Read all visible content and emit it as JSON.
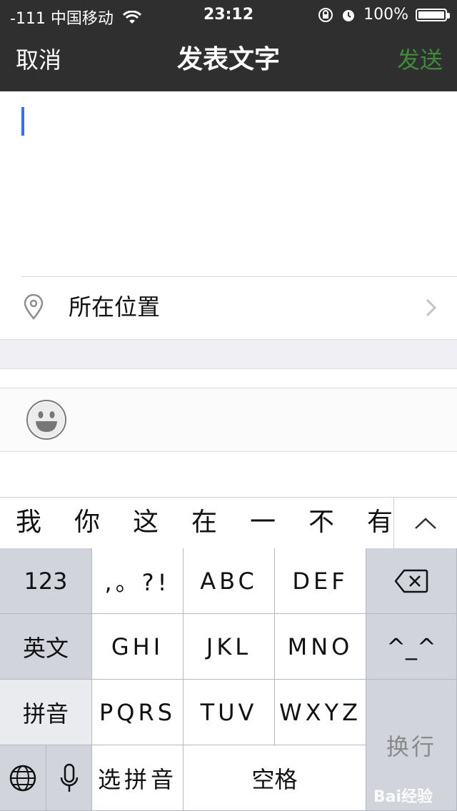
{
  "status_bar": {
    "carrier": "-111 中国移动",
    "time": "23:12",
    "battery": "100%"
  },
  "nav": {
    "cancel": "取消",
    "title": "发表文字",
    "send": "发送"
  },
  "location": {
    "label": "所在位置"
  },
  "candidates": [
    "我",
    "你",
    "这",
    "在",
    "一",
    "不",
    "有"
  ],
  "keyboard": {
    "left_col": [
      "123",
      "英文",
      "拼音"
    ],
    "rows": [
      [
        ",。?!",
        "ABC",
        "DEF"
      ],
      [
        "GHI",
        "JKL",
        "MNO"
      ],
      [
        "PQRS",
        "TUV",
        "WXYZ"
      ]
    ],
    "emoticon": "^_^",
    "select_pinyin": "选拼音",
    "space": "空格",
    "return": "换行"
  },
  "watermark": "Bai经验"
}
